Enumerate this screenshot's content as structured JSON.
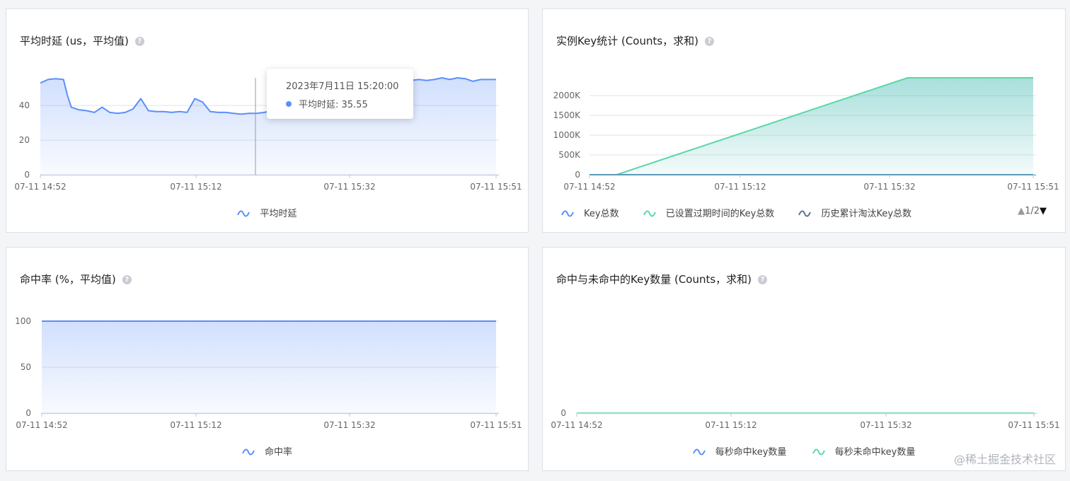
{
  "watermark": "@稀土掘金技术社区",
  "panels": [
    {
      "title": "平均时延 (us，平均值)",
      "help": "?",
      "legend": [
        {
          "label": "平均时延",
          "color": "#5b8ff9"
        }
      ],
      "tooltip": {
        "time": "2023年7月11日 15:20:00",
        "label": "平均时延: 35.55",
        "color": "#5b8ff9"
      }
    },
    {
      "title": "实例Key统计 (Counts，求和)",
      "help": "?",
      "legend": [
        {
          "label": "Key总数",
          "color": "#5b8ff9"
        },
        {
          "label": "已设置过期时间的Key总数",
          "color": "#5ad8a6"
        },
        {
          "label": "历史累计淘汰Key总数",
          "color": "#5d7092"
        }
      ],
      "pager": {
        "up": "▲",
        "text": "1/2",
        "down": "▼"
      }
    },
    {
      "title": "命中率 (%，平均值)",
      "help": "?",
      "legend": [
        {
          "label": "命中率",
          "color": "#5b8ff9"
        }
      ]
    },
    {
      "title": "命中与未命中的Key数量 (Counts，求和)",
      "help": "?",
      "legend": [
        {
          "label": "每秒命中key数量",
          "color": "#5b8ff9"
        },
        {
          "label": "每秒未命中key数量",
          "color": "#5ad8a6"
        }
      ]
    }
  ],
  "chart_data": [
    {
      "type": "area",
      "title": "平均时延 (us，平均值)",
      "x_ticks": [
        "07-11 14:52",
        "07-11 15:12",
        "07-11 15:32",
        "07-11 15:51"
      ],
      "y_ticks": [
        "0",
        "20",
        "40"
      ],
      "ylim": [
        0,
        56
      ],
      "xlim_minutes": [
        0,
        59
      ],
      "grid": true,
      "series": [
        {
          "name": "平均时延",
          "color": "#5b8ff9",
          "x": [
            0,
            1,
            2,
            3,
            3.5,
            4,
            5,
            6,
            7,
            8,
            9,
            10,
            11,
            12,
            13,
            14,
            15,
            16,
            17,
            18,
            19,
            20,
            21,
            22,
            23,
            24,
            25,
            26,
            27,
            28,
            29,
            30,
            31,
            32,
            33,
            34,
            35,
            36,
            37,
            38,
            39,
            40,
            41,
            42,
            43,
            44,
            45,
            46,
            47,
            48,
            49,
            50,
            51,
            52,
            53,
            54,
            55,
            56,
            57,
            58,
            59
          ],
          "y": [
            53,
            55,
            55.5,
            55,
            46,
            39,
            37.5,
            37,
            36,
            39,
            36,
            35.5,
            36,
            38,
            44,
            37,
            36.5,
            36.5,
            36,
            36.5,
            36,
            44,
            42,
            36.5,
            36,
            36,
            35.5,
            35,
            35.5,
            35.5,
            36,
            37,
            38,
            39,
            40,
            40,
            41,
            42,
            43,
            44,
            45,
            46,
            47,
            48,
            50,
            51,
            52,
            53,
            54,
            54.5,
            55,
            54.5,
            55,
            56,
            55,
            56,
            55.5,
            54,
            55,
            55,
            55
          ]
        }
      ]
    },
    {
      "type": "area",
      "title": "实例Key统计 (Counts，求和)",
      "x_ticks": [
        "07-11 14:52",
        "07-11 15:12",
        "07-11 15:32",
        "07-11 15:51"
      ],
      "y_ticks": [
        "0",
        "500K",
        "1000K",
        "1500K",
        "2000K"
      ],
      "ylim": [
        0,
        2450000
      ],
      "xlim_minutes": [
        0,
        59
      ],
      "grid": true,
      "series": [
        {
          "name": "Key总数",
          "color": "#5b8ff9",
          "x": [
            0,
            59
          ],
          "y": [
            0,
            0
          ]
        },
        {
          "name": "已设置过期时间的Key总数",
          "color": "#5ad8a6",
          "x": [
            0,
            3.6,
            42.3,
            59
          ],
          "y": [
            0,
            0,
            2450000,
            2450000
          ]
        },
        {
          "name": "历史累计淘汰Key总数",
          "color": "#5d7092",
          "x": [
            0,
            59
          ],
          "y": [
            0,
            0
          ]
        }
      ]
    },
    {
      "type": "area",
      "title": "命中率 (%，平均值)",
      "x_ticks": [
        "07-11 14:52",
        "07-11 15:12",
        "07-11 15:32",
        "07-11 15:51"
      ],
      "y_ticks": [
        "0",
        "50",
        "100"
      ],
      "ylim": [
        0,
        100
      ],
      "xlim_minutes": [
        0,
        59
      ],
      "grid": true,
      "series": [
        {
          "name": "命中率",
          "color": "#5b8ff9",
          "x": [
            0,
            59
          ],
          "y": [
            100,
            100
          ]
        }
      ]
    },
    {
      "type": "line",
      "title": "命中与未命中的Key数量 (Counts，求和)",
      "x_ticks": [
        "07-11 14:52",
        "07-11 15:12",
        "07-11 15:32",
        "07-11 15:51"
      ],
      "y_ticks": [
        "0"
      ],
      "ylim": [
        0,
        1
      ],
      "xlim_minutes": [
        0,
        59
      ],
      "grid": false,
      "series": [
        {
          "name": "每秒命中key数量",
          "color": "#5b8ff9",
          "x": [
            0,
            59
          ],
          "y": [
            0,
            0
          ]
        },
        {
          "name": "每秒未命中key数量",
          "color": "#5ad8a6",
          "x": [
            0,
            59
          ],
          "y": [
            0,
            0
          ]
        }
      ]
    }
  ]
}
